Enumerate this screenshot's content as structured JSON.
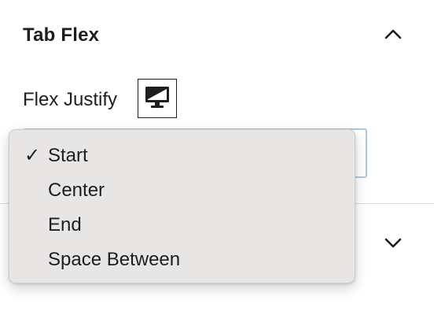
{
  "panel": {
    "title": "Tab Flex",
    "toggle_icon": "chevron-up-icon",
    "field_label": "Flex Justify",
    "device_icon": "desktop-monitor-icon",
    "next_panel_toggle_icon": "chevron-down-icon"
  },
  "dropdown": {
    "selected": "Start",
    "check_mark": "✓",
    "options": [
      {
        "label": "Start",
        "checked": true
      },
      {
        "label": "Center",
        "checked": false
      },
      {
        "label": "End",
        "checked": false
      },
      {
        "label": "Space Between",
        "checked": false
      }
    ]
  },
  "colors": {
    "text": "#1e1e1e",
    "select_focus_border": "#aac8e6",
    "dropdown_bg": "#e8e5e5",
    "divider": "#dddddd"
  }
}
